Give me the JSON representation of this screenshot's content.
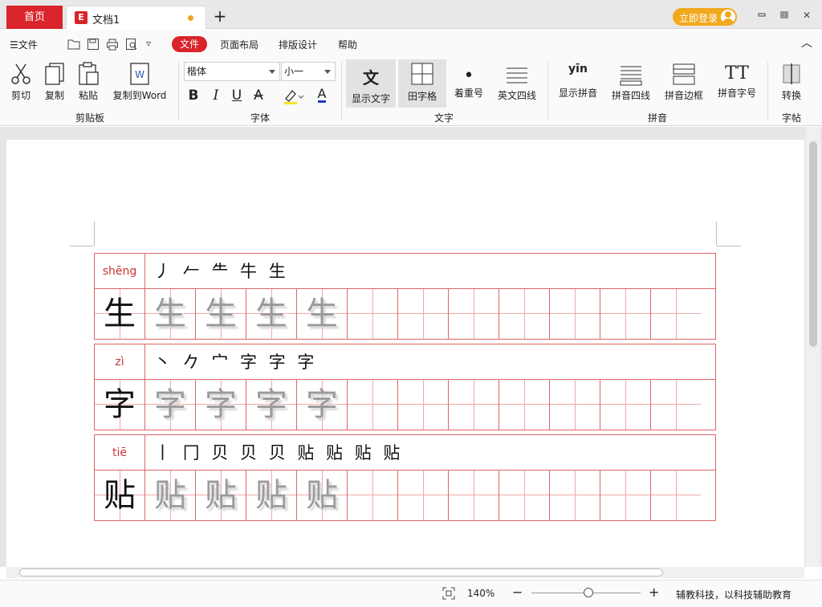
{
  "titlebar": {
    "home_tab": "首页",
    "doc_logo": "E",
    "doc_tab": "文档1",
    "new_tab": "+",
    "login": "立即登录",
    "minimize": "▭",
    "restore": "▢",
    "close": "✕"
  },
  "menubar": {
    "file_menu": "☰文件",
    "customize": "▿",
    "items": [
      "文件",
      "页面布局",
      "排版设计",
      "帮助"
    ],
    "collapse": "︿"
  },
  "ribbon": {
    "clipboard": {
      "cut": "剪切",
      "copy": "复制",
      "paste": "粘贴",
      "copy_word": "复制到Word",
      "group": "剪贴板"
    },
    "font": {
      "family": "楷体",
      "size": "小一",
      "bold": "B",
      "italic": "I",
      "underline": "U",
      "strike": "A",
      "font_color": "A",
      "group": "字体"
    },
    "text": {
      "show_text": "显示文字",
      "show_text_glyph": "文",
      "tianzige": "田字格",
      "emphasis": "着重号",
      "emphasis_glyph": "•",
      "english_four": "英文四线",
      "group": "文字"
    },
    "pinyin": {
      "show_pinyin": "显示拼音",
      "pinyin_glyph": "yīn",
      "pinyin_four": "拼音四线",
      "pinyin_border": "拼音边框",
      "pinyin_size": "拼音字号",
      "pinyin_size_glyph": "TT",
      "group": "拼音"
    },
    "zitie": {
      "convert": "转换",
      "group": "字帖"
    }
  },
  "document": {
    "rows": [
      {
        "pinyin": "shēng",
        "strokes": "丿 𠂉 ⺧ 牛 生",
        "char": "生",
        "traces": [
          "生",
          "生",
          "生",
          "生"
        ]
      },
      {
        "pinyin": "zì",
        "strokes": "丶 𠂊 宀 字 字 字",
        "char": "字",
        "traces": [
          "字",
          "字",
          "字",
          "字"
        ]
      },
      {
        "pinyin": "tiē",
        "strokes": "丨 冂 贝 贝 贝 贴 贴 贴 贴",
        "char": "贴",
        "traces": [
          "贴",
          "贴",
          "贴",
          "贴"
        ]
      }
    ]
  },
  "statusbar": {
    "zoom": "140%",
    "zoom_minus": "−",
    "zoom_plus": "+",
    "zoom_level": 0.52,
    "slogan": "辅教科技，以科技辅助教育"
  },
  "colors": {
    "accent": "#d8242a",
    "login": "#f2a81d",
    "grid": "#dd6666"
  }
}
